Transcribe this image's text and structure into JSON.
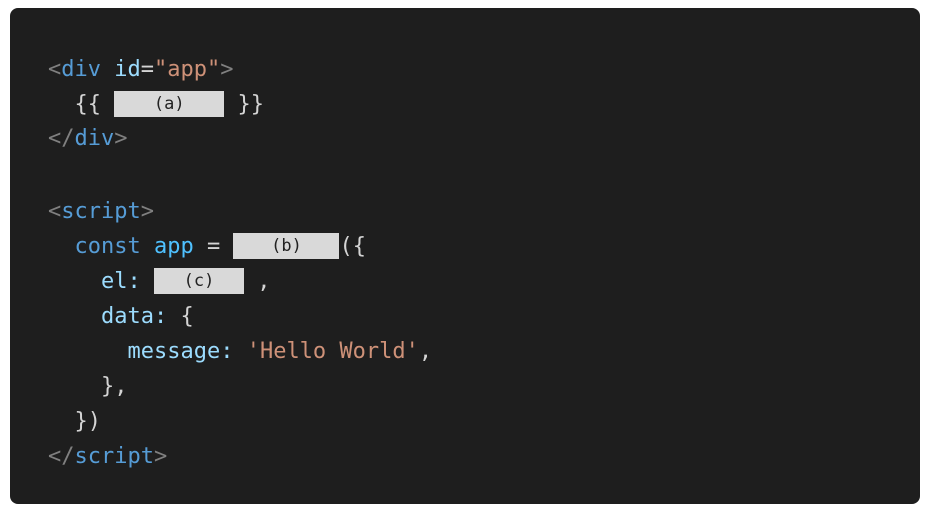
{
  "code": {
    "line1": {
      "open_bracket": "<",
      "tag": "div",
      "attr": "id",
      "equals": "=",
      "value": "\"app\"",
      "close_bracket": ">"
    },
    "line2": {
      "open": "{{",
      "blank_a": "(a)",
      "close": "}}"
    },
    "line3": {
      "open_bracket": "</",
      "tag": "div",
      "close_bracket": ">"
    },
    "line5": {
      "open_bracket": "<",
      "tag": "script",
      "close_bracket": ">"
    },
    "line6": {
      "keyword": "const",
      "name": "app",
      "equals": "=",
      "blank_b": "(b)",
      "tail": "({"
    },
    "line7": {
      "prop": "el:",
      "blank_c": "(c)",
      "tail": ","
    },
    "line8": {
      "prop": "data:",
      "tail": "{"
    },
    "line9": {
      "prop": "message:",
      "string": "'Hello World'",
      "tail": ","
    },
    "line10": {
      "text": "},"
    },
    "line11": {
      "text": "})"
    },
    "line12": {
      "open_bracket": "</",
      "tag": "script",
      "close_bracket": ">"
    }
  },
  "colors": {
    "background": "#1e1e1e",
    "tag": "#569cd6",
    "attribute": "#9cdcfe",
    "string": "#ce9178",
    "bracket": "#808080",
    "text": "#d4d4d4",
    "blank": "#d9d9d9"
  }
}
